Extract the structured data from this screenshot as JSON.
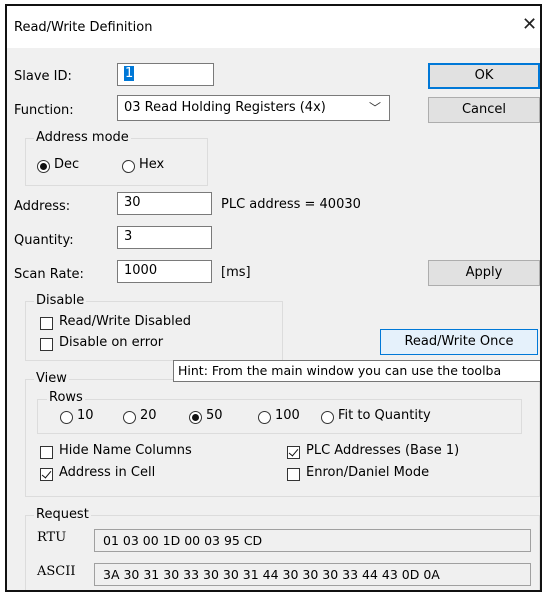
{
  "window": {
    "title": "Read/Write Definition",
    "close_glyph": "✕"
  },
  "form": {
    "slave_id_label": "Slave ID:",
    "slave_id_value": "1",
    "function_label": "Function:",
    "function_value": "03 Read Holding Registers (4x)",
    "address_label": "Address:",
    "address_value": "30",
    "plc_address_text": "PLC address = 40030",
    "quantity_label": "Quantity:",
    "quantity_value": "3",
    "scan_rate_label": "Scan Rate:",
    "scan_rate_value": "1000",
    "scan_rate_unit": "[ms]"
  },
  "buttons": {
    "ok": "OK",
    "cancel": "Cancel",
    "apply": "Apply",
    "read_write_once": "Read/Write Once"
  },
  "address_mode": {
    "label": "Address mode",
    "dec": "Dec",
    "hex": "Hex",
    "selected": "Dec"
  },
  "disable": {
    "label": "Disable",
    "read_write_disabled": "Read/Write Disabled",
    "disable_on_error": "Disable on error"
  },
  "tooltip": "Hint: From the main window you can use the toolba",
  "view": {
    "label": "View",
    "rows_label": "Rows",
    "rows_options": [
      "10",
      "20",
      "50",
      "100",
      "Fit to Quantity"
    ],
    "rows_selected": "50",
    "hide_name_columns": "Hide Name Columns",
    "address_in_cell": "Address in Cell",
    "plc_addresses": "PLC Addresses (Base 1)",
    "enron_daniel": "Enron/Daniel Mode",
    "checked": {
      "hide_name_columns": false,
      "address_in_cell": true,
      "plc_addresses": true,
      "enron_daniel": false
    }
  },
  "request": {
    "label": "Request",
    "rtu_label": "RTU",
    "rtu_value": "01 03 00 1D 00 03 95 CD",
    "ascii_label": "ASCII",
    "ascii_value": "3A 30 31 30 33 30 30 31 44 30 30 30 33 44 43 0D 0A"
  },
  "colors": {
    "accent": "#0078d7",
    "dialog_bg": "#f0f0f0"
  }
}
